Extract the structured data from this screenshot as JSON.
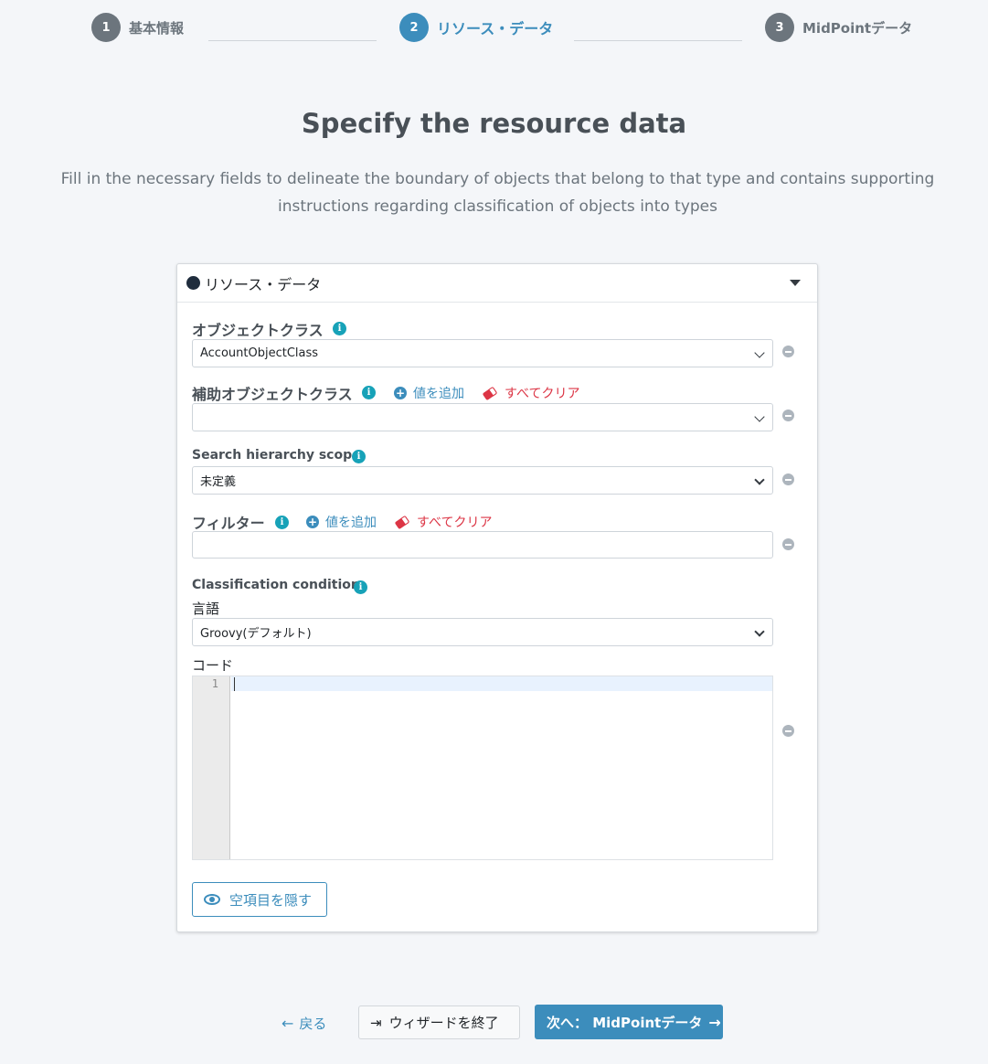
{
  "stepper": {
    "steps": [
      {
        "number": "1",
        "label": "基本情報"
      },
      {
        "number": "2",
        "label": "リソース・データ"
      },
      {
        "number": "3",
        "label": "MidPointデータ"
      }
    ],
    "active_step": 2
  },
  "page": {
    "title": "Specify the resource data",
    "subtitle": "Fill in the necessary fields to delineate the boundary of objects that belong to that type and contains supporting instructions regarding classification of objects into types"
  },
  "card": {
    "title": "リソース・データ",
    "fields": {
      "object_class": {
        "label": "オブジェクトクラス",
        "value": "AccountObjectClass"
      },
      "aux_object_class": {
        "label": "補助オブジェクトクラス",
        "value": "",
        "add_label": "値を追加",
        "clear_label": "すべてクリア"
      },
      "search_scope": {
        "label": "Search hierarchy scope",
        "value": "未定義"
      },
      "filter": {
        "label": "フィルター",
        "value": "",
        "add_label": "値を追加",
        "clear_label": "すべてクリア"
      },
      "classification": {
        "label": "Classification condition",
        "language_label": "言語",
        "language_value": "Groovy(デフォルト)",
        "code_label": "コード",
        "line_number": "1"
      }
    },
    "hide_empty_label": "空項目を隠す"
  },
  "footer": {
    "back_label": "戻る",
    "exit_label": "ウィザードを終了",
    "next_label": "次へ：  MidPointデータ"
  },
  "colors": {
    "accent": "#3c8dbc",
    "danger": "#dc3545",
    "info": "#17a2b8",
    "inactive": "#6c757d"
  }
}
